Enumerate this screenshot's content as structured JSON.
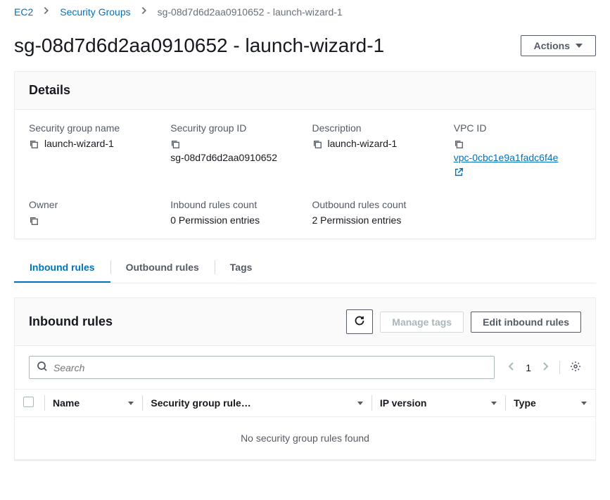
{
  "breadcrumb": {
    "items": [
      "EC2",
      "Security Groups"
    ],
    "current": "sg-08d7d6d2aa0910652 - launch-wizard-1"
  },
  "page_title": "sg-08d7d6d2aa0910652 - launch-wizard-1",
  "actions_label": "Actions",
  "details_panel": {
    "title": "Details",
    "items": [
      {
        "label": "Security group name",
        "value": "launch-wizard-1",
        "copy": true
      },
      {
        "label": "Security group ID",
        "value": "sg-08d7d6d2aa0910652",
        "copy": true,
        "stacked": true
      },
      {
        "label": "Description",
        "value": "launch-wizard-1",
        "copy": true
      },
      {
        "label": "VPC ID",
        "value": "vpc-0cbc1e9a1fadc6f4e",
        "copy": true,
        "link": true,
        "external": true,
        "stacked": true
      },
      {
        "label": "Owner",
        "value": "",
        "copy": true
      },
      {
        "label": "Inbound rules count",
        "value": "0 Permission entries"
      },
      {
        "label": "Outbound rules count",
        "value": "2 Permission entries"
      }
    ]
  },
  "tabs": [
    {
      "label": "Inbound rules",
      "active": true
    },
    {
      "label": "Outbound rules",
      "active": false
    },
    {
      "label": "Tags",
      "active": false
    }
  ],
  "rules_panel": {
    "title": "Inbound rules",
    "manage_tags": "Manage tags",
    "edit_rules": "Edit inbound rules",
    "search_placeholder": "Search",
    "page": "1",
    "columns": [
      "Name",
      "Security group rule…",
      "IP version",
      "Type"
    ],
    "empty_text": "No security group rules found"
  }
}
